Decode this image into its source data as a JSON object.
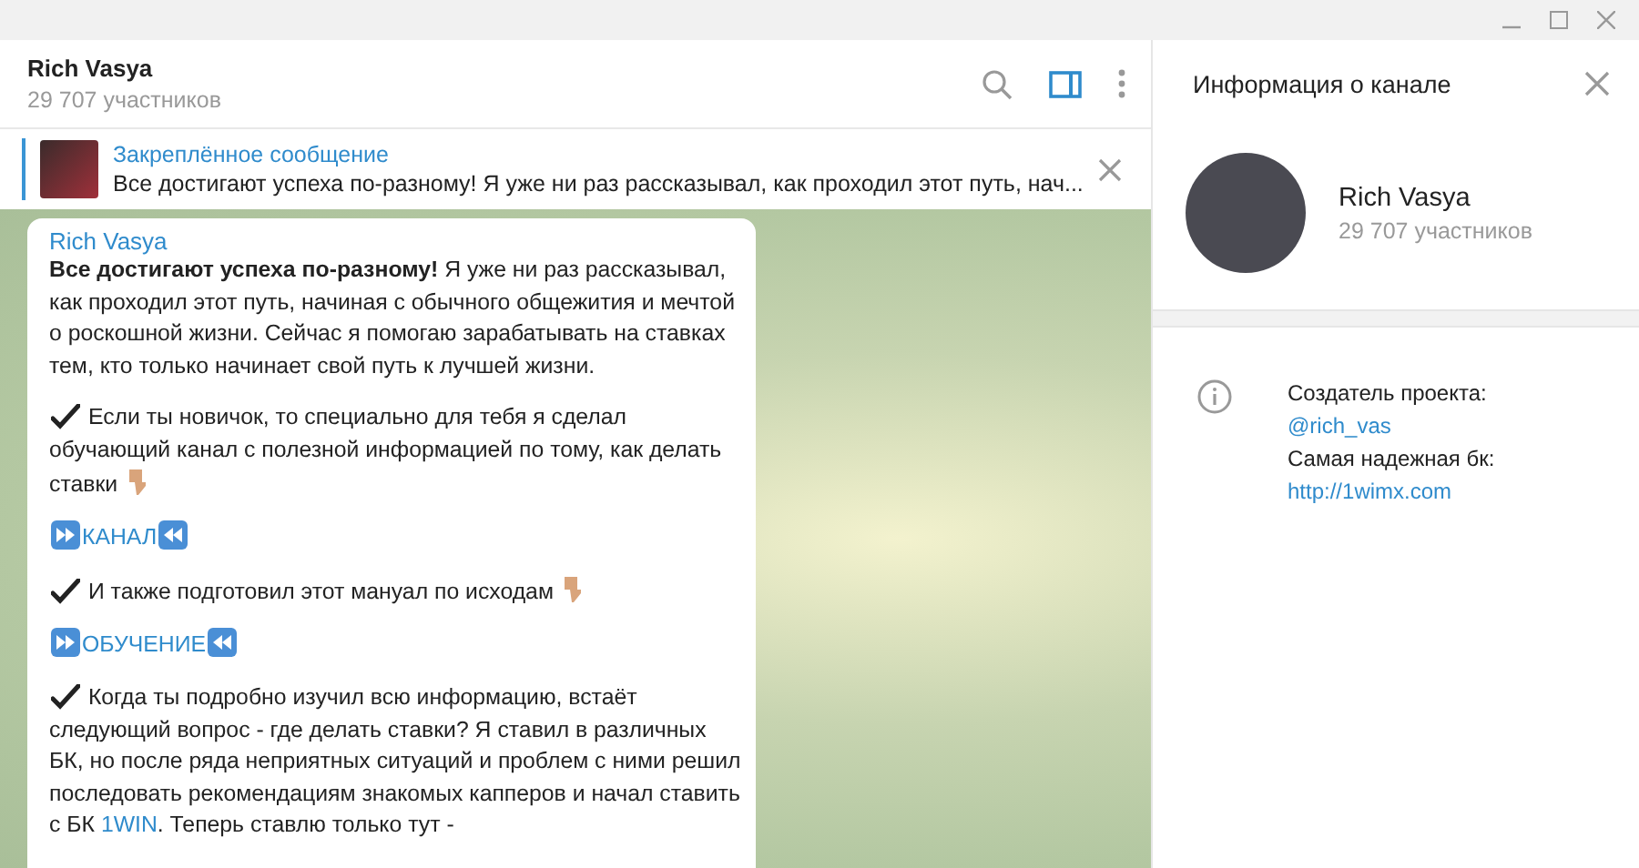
{
  "chat": {
    "title": "Rich Vasya",
    "subtitle": "29 707 участников",
    "panel_open": true
  },
  "pinned": {
    "label": "Закреплённое сообщение",
    "text": "Все достигают успеха по-разному! Я уже ни раз рассказывал, как проходил этот путь, нач..."
  },
  "message": {
    "author": "Rich Vasya",
    "paragraphs": [
      {
        "kind": "text",
        "segments": [
          {
            "text": "**Все достигают успеха по-разному!** Я уже ни раз рассказывал, как проходил этот путь, начиная с обычного общежития и мечтой о роскошной жизни. Сейчас я помогаю зарабатывать на ставках тем, кто только начинает свой путь к лучшей жизни.",
            "link": false
          }
        ],
        "hand": false
      },
      {
        "kind": "check",
        "segments": [
          {
            "text": "Если ты новичок, то специально для тебя я сделал обучающий канал с  полезной информацией по тому, как делать ставки",
            "link": false
          }
        ],
        "hand": true
      },
      {
        "kind": "link",
        "segments": [
          {
            "text": "КАНАЛ",
            "link": true
          }
        ],
        "hand": false
      },
      {
        "kind": "check",
        "segments": [
          {
            "text": "И также подготовил этот мануал по исходам",
            "link": false
          }
        ],
        "hand": true
      },
      {
        "kind": "link",
        "segments": [
          {
            "text": "ОБУЧЕНИЕ",
            "link": true
          }
        ],
        "hand": false
      },
      {
        "kind": "check",
        "segments": [
          {
            "text": "Когда ты подробно изучил всю информацию, встаёт следующий вопрос - где делать ставки? Я ставил в различных БК, но после ряда неприятных ситуаций и проблем с ними решил последовать рекомендациям знакомых капперов и начал ставить с БК ",
            "link": false
          },
          {
            "text": "1WIN",
            "link": true
          },
          {
            "text": ". Теперь ставлю только тут -",
            "link": false
          }
        ],
        "hand": false
      }
    ]
  },
  "info_panel": {
    "title": "Информация о канале",
    "name": "Rich Vasya",
    "subtitle": "29 707 участников",
    "details": [
      {
        "kind": "label",
        "text": "Создатель проекта:"
      },
      {
        "kind": "link",
        "text": "@rich_vas"
      },
      {
        "kind": "label",
        "text": "Самая надежная бк:"
      },
      {
        "kind": "link",
        "text": "http://1wimx.com"
      }
    ]
  }
}
